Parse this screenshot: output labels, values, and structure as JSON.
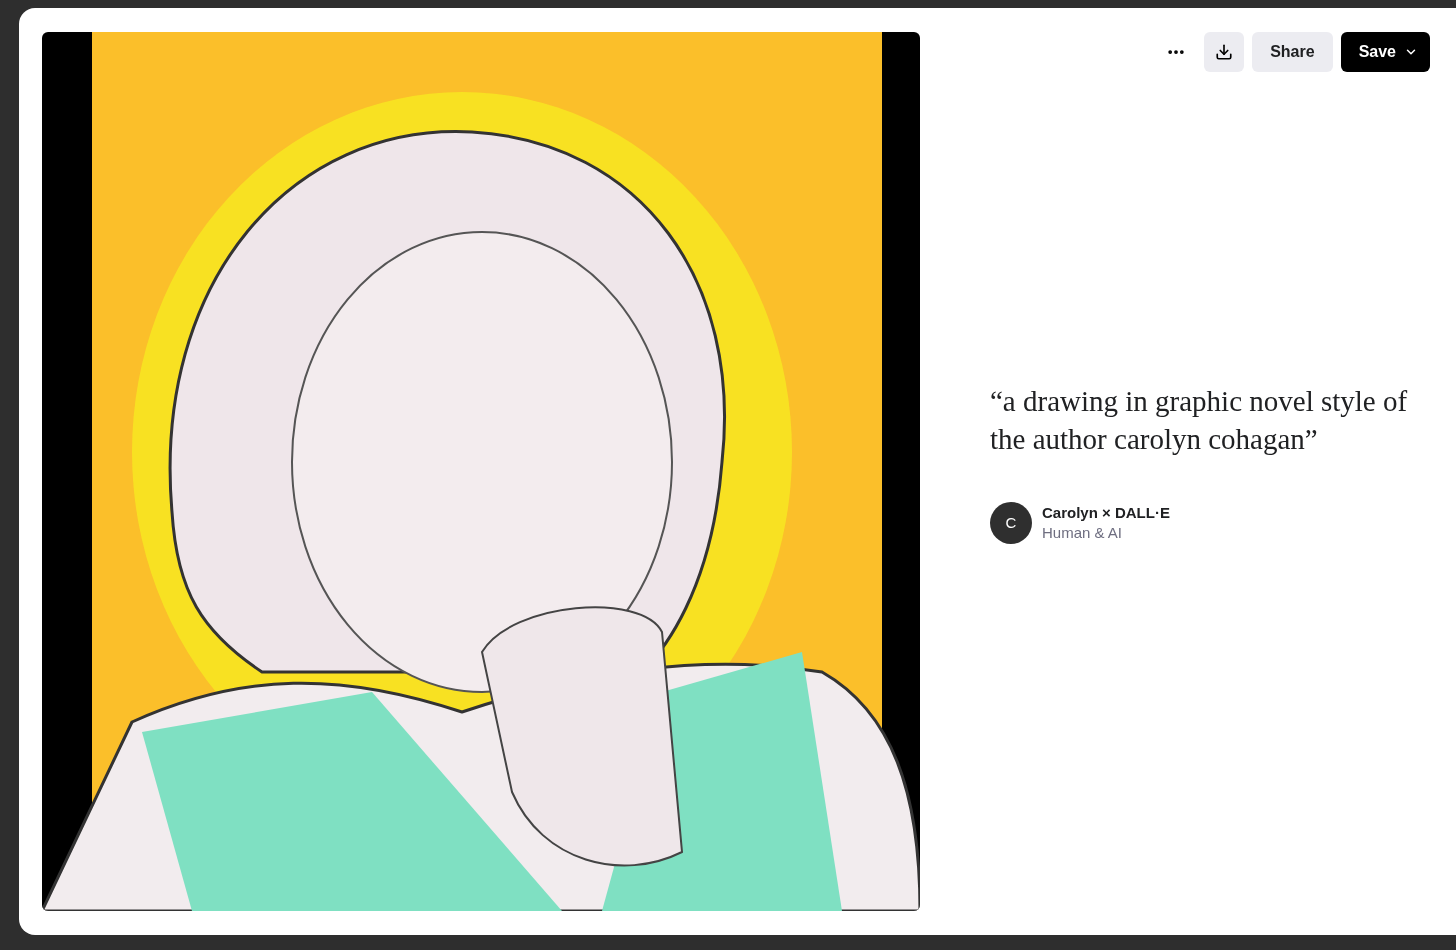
{
  "toolbar": {
    "share_label": "Share",
    "save_label": "Save"
  },
  "prompt": "“a drawing in graphic novel style of the author carolyn cohagan”",
  "author": {
    "initial": "C",
    "name": "Carolyn × DALL·E",
    "subtitle": "Human & AI"
  }
}
